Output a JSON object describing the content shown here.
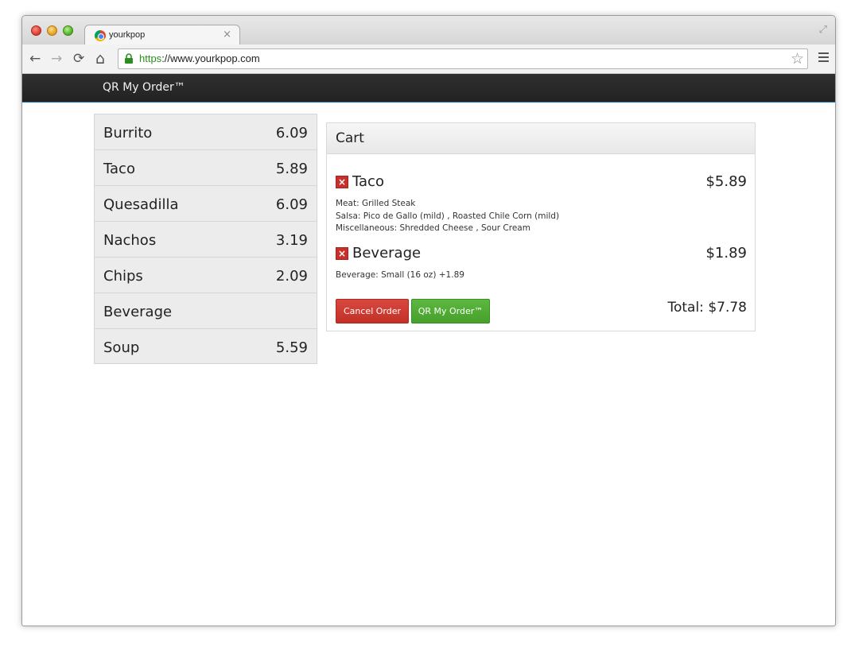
{
  "browser": {
    "tab_title": "yourkpop",
    "tab_close": "×",
    "url_scheme": "https",
    "url_rest": "://www.yourkpop.com",
    "nav": {
      "back": "←",
      "forward": "→",
      "reload": "⟳",
      "home": "⌂"
    },
    "star": "☆",
    "fullscreen": "⤢"
  },
  "navbar": {
    "brand": "QR My Order™"
  },
  "menu": {
    "items": [
      {
        "name": "Burrito",
        "price": "6.09"
      },
      {
        "name": "Taco",
        "price": "5.89"
      },
      {
        "name": "Quesadilla",
        "price": "6.09"
      },
      {
        "name": "Nachos",
        "price": "3.19"
      },
      {
        "name": "Chips",
        "price": "2.09"
      },
      {
        "name": "Beverage",
        "price": ""
      },
      {
        "name": "Soup",
        "price": "5.59"
      }
    ]
  },
  "cart": {
    "title": "Cart",
    "items": [
      {
        "name": "Taco",
        "price": "$5.89",
        "details": [
          "Meat: Grilled Steak",
          "Salsa: Pico de Gallo (mild) , Roasted Chile Corn (mild)",
          "Miscellaneous: Shredded Cheese , Sour Cream"
        ]
      },
      {
        "name": "Beverage",
        "price": "$1.89",
        "details": [
          "Beverage: Small (16 oz) +1.89"
        ]
      }
    ],
    "cancel_label": "Cancel Order",
    "submit_label": "QR My Order™",
    "total": "Total: $7.78"
  },
  "colors": {
    "navbar": "#262626",
    "cancel": "#c9302c",
    "submit": "#4caf30",
    "url_scheme": "#2a8f1e"
  },
  "icons": [
    "back-icon",
    "forward-icon",
    "reload-icon",
    "home-icon",
    "lock-icon",
    "star-icon",
    "menu-icon",
    "remove-icon"
  ]
}
